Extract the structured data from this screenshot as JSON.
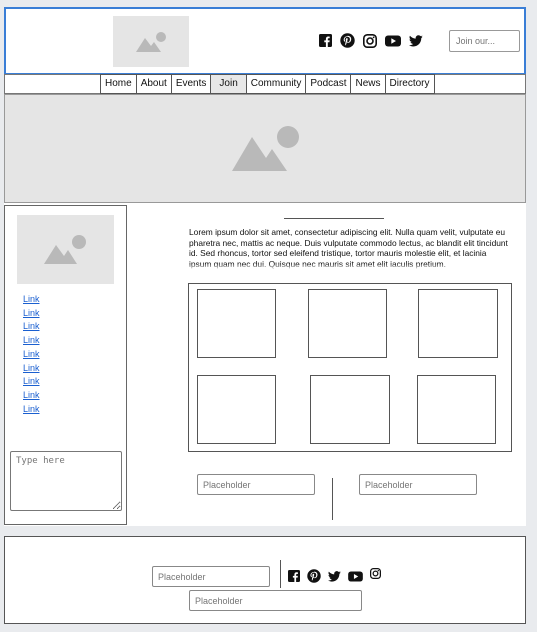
{
  "header": {
    "search_placeholder": "Join our..."
  },
  "nav": {
    "items": [
      {
        "label": "Home"
      },
      {
        "label": "About"
      },
      {
        "label": "Events"
      },
      {
        "label": "Join",
        "active": true
      },
      {
        "label": "Community"
      },
      {
        "label": "Podcast"
      },
      {
        "label": "News"
      },
      {
        "label": "Directory"
      }
    ]
  },
  "sidebar": {
    "links": [
      "Link",
      "Link",
      "Link",
      "Link",
      "Link",
      "Link",
      "Link",
      "Link",
      "Link"
    ],
    "textarea_placeholder": "Type here"
  },
  "main": {
    "body_text": "Lorem ipsum dolor sit amet, consectetur adipiscing elit. Nulla quam velit, vulputate eu pharetra nec, mattis ac neque. Duis vulputate commodo lectus, ac blandit elit tincidunt id. Sed rhoncus, tortor sed eleifend tristique, tortor mauris molestie elit, et lacinia ipsum quam nec dui. Quisque nec mauris sit amet elit iaculis pretium.",
    "field_left_placeholder": "Placeholder",
    "field_right_placeholder": "Placeholder"
  },
  "footer": {
    "field_top_placeholder": "Placeholder",
    "field_bottom_placeholder": "Placeholder"
  },
  "icons": {
    "social": [
      "facebook-icon",
      "pinterest-icon",
      "instagram-icon",
      "youtube-icon",
      "twitter-icon"
    ]
  },
  "colors": {
    "header_border": "#3a7ed6",
    "link": "#1a5fd0",
    "placeholder_block": "#e5e5e5"
  }
}
